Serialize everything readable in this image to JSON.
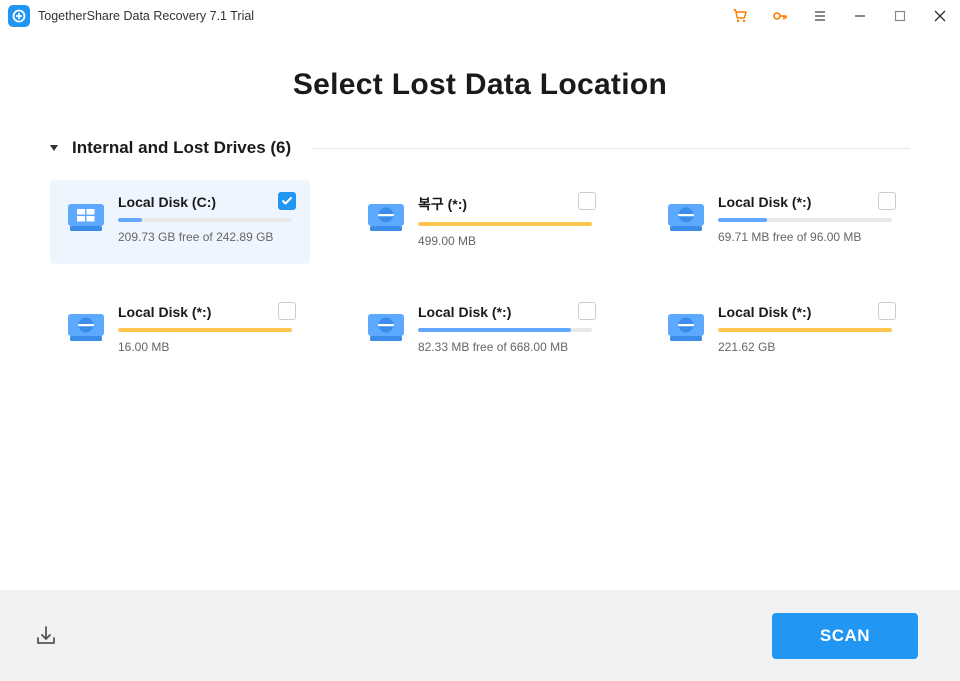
{
  "titlebar": {
    "app_name": "TogetherShare Data Recovery 7.1 Trial"
  },
  "page_title": "Select Lost Data Location",
  "section": {
    "title": "Internal and Lost Drives (6)"
  },
  "drives": [
    {
      "name": "Local Disk (C:)",
      "status": "209.73 GB free of 242.89 GB",
      "bar_color": "blue",
      "bar_pct": 14,
      "selected": true,
      "icon_type": "windows"
    },
    {
      "name": "복구 (*:)",
      "status": "499.00 MB",
      "bar_color": "orange",
      "bar_pct": 100,
      "selected": false,
      "icon_type": "disk"
    },
    {
      "name": "Local Disk (*:)",
      "status": "69.71 MB free of 96.00 MB",
      "bar_color": "blue",
      "bar_pct": 28,
      "selected": false,
      "icon_type": "disk"
    },
    {
      "name": "Local Disk (*:)",
      "status": "16.00 MB",
      "bar_color": "orange",
      "bar_pct": 100,
      "selected": false,
      "icon_type": "disk"
    },
    {
      "name": "Local Disk (*:)",
      "status": "82.33 MB free of 668.00 MB",
      "bar_color": "blue",
      "bar_pct": 88,
      "selected": false,
      "icon_type": "disk"
    },
    {
      "name": "Local Disk (*:)",
      "status": "221.62 GB",
      "bar_color": "orange",
      "bar_pct": 100,
      "selected": false,
      "icon_type": "disk"
    }
  ],
  "footer": {
    "scan_label": "SCAN"
  }
}
